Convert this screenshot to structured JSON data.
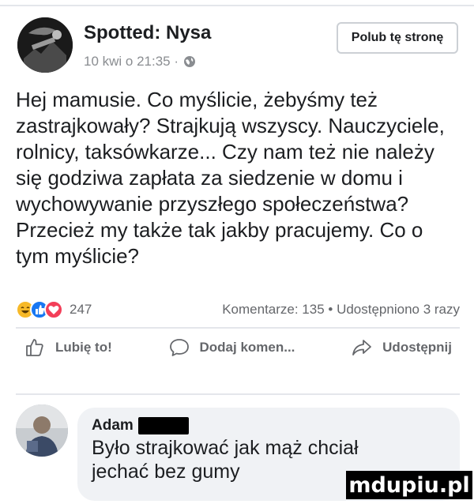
{
  "post": {
    "page_name": "Spotted: Nysa",
    "meta_time": "10 kwi o 21:35 ·",
    "visibility_icon": "globe-icon",
    "like_page_label": "Polub tę stronę",
    "body": "Hej mamusie. Co myślicie, żebyśmy też\nzastrajkowały? Strajkują wszyscy. Nauczyciele,\nrolnicy, taksówkarze... Czy nam też nie należy\nsię godziwa zapłata za siedzenie w domu i\nwychowywanie przyszłego społeczeństwa?\nPrzecież my także tak jakby pracujemy. Co o\ntym myślicie?"
  },
  "stats": {
    "reactions": [
      "haha",
      "like",
      "love"
    ],
    "reaction_colors": {
      "haha": "#f7b928",
      "like": "#1877f2",
      "love": "#f33e58"
    },
    "reaction_count": "247",
    "comments_shares": "Komentarze: 135 • Udostępniono 3 razy"
  },
  "actions": {
    "like_label": "Lubię to!",
    "comment_label": "Dodaj komen...",
    "share_label": "Udostępnij"
  },
  "comment": {
    "author": "Adam",
    "text": "Było strajkować jak mąż chciał\njechać bez gumy"
  },
  "watermark": {
    "text": "mdupiu.pl"
  },
  "colors": {
    "text": "#1c1e21",
    "secondary": "#65676b",
    "bubble": "#f0f2f5"
  }
}
